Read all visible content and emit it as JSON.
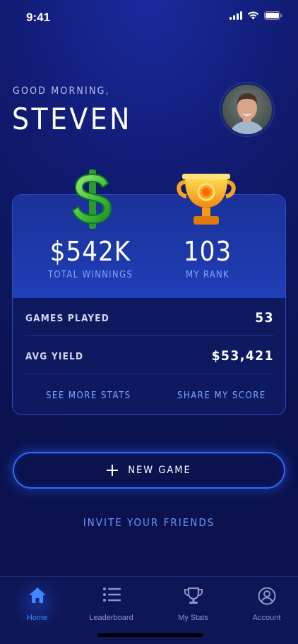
{
  "status_bar": {
    "time": "9:41"
  },
  "greeting": {
    "subtitle": "GOOD MORNING,",
    "name": "STEVEN"
  },
  "stats_card": {
    "winnings": {
      "value": "$542K",
      "label": "TOTAL WINNINGS"
    },
    "rank": {
      "value": "103",
      "label": "MY RANK"
    },
    "rows": [
      {
        "label": "GAMES PLAYED",
        "value": "53"
      },
      {
        "label": "AVG YIELD",
        "value": "$53,421"
      }
    ],
    "links": {
      "more_stats": "SEE MORE STATS",
      "share": "SHARE MY SCORE"
    }
  },
  "actions": {
    "new_game": "NEW GAME",
    "invite": "INVITE YOUR FRIENDS"
  },
  "tab_bar": {
    "items": [
      {
        "label": "Home",
        "icon": "home-icon",
        "active": true
      },
      {
        "label": "Leaderboard",
        "icon": "list-icon",
        "active": false
      },
      {
        "label": "My Stats",
        "icon": "trophy-icon",
        "active": false
      },
      {
        "label": "Account",
        "icon": "user-icon",
        "active": false
      }
    ]
  },
  "colors": {
    "background": "#101a6e",
    "accent": "#2b6bff",
    "link": "#7ea6ff",
    "card_top": "#1f3fb8"
  }
}
